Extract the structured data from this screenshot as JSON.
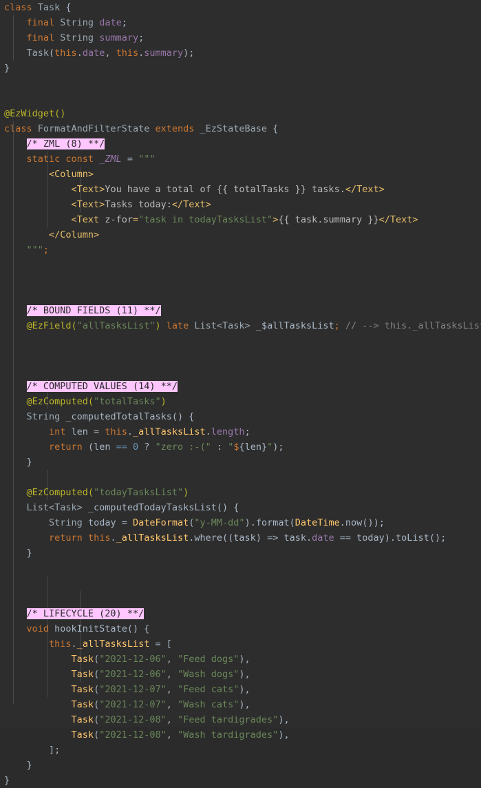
{
  "editor": {
    "background": "#2d2d2d",
    "language": "dart",
    "indent_guide_color": "#4a4a4a",
    "highlight_color": "#ffc6ff",
    "colors": {
      "keyword": "#cc7832",
      "type": "#9aa7b0",
      "field": "#9876aa",
      "string": "#6a8759",
      "annotation": "#bbb529",
      "comment": "#808080",
      "number": "#6897bb",
      "function": "#ffc66d",
      "default": "#a9b7c6",
      "xml_tag": "#e8bf6a"
    }
  },
  "section_headers": [
    {
      "label": "/* ZML (8) **/",
      "line": 8
    },
    {
      "label": "/* BOUND FIELDS (11) **/",
      "line": 11
    },
    {
      "label": "/* COMPUTED VALUES (14) **/",
      "line": 14
    },
    {
      "label": "/* LIFECYCLE (20) **/",
      "line": 20
    }
  ],
  "code": {
    "l1": {
      "kw1": "class",
      "name": " Task ",
      "brace": "{"
    },
    "l2": {
      "kw": "final",
      "type": " String ",
      "field": "date",
      "semi": ";"
    },
    "l3": {
      "kw": "final",
      "type": " String ",
      "field": "summary",
      "semi": ";"
    },
    "l4": {
      "fn": "Task",
      "p1": "(",
      "kw1": "this",
      "d1": ".",
      "f1": "date",
      "c": ", ",
      "kw2": "this",
      "d2": ".",
      "f2": "summary",
      "p2": ");"
    },
    "l5": {
      "brace": "}"
    },
    "l7": {
      "anno": "@EzWidget()"
    },
    "l8": {
      "kw": "class",
      "name": " FormatAndFilterState ",
      "kw2": "extends",
      "base": " _EzStateBase ",
      "brace": "{"
    },
    "l9": {
      "header": "/* ZML (8) **/"
    },
    "l10": {
      "kw1": "static",
      "kw2": " const ",
      "field": "_ZML",
      "eq": " = ",
      "str": "\"\"\""
    },
    "l11": {
      "tag": "<Column>"
    },
    "l12": {
      "open": "<Text>",
      "text": "You have a total of {{ totalTasks }} tasks.",
      "close": "</Text>"
    },
    "l13": {
      "open": "<Text>",
      "text": "Tasks today:",
      "close": "</Text>"
    },
    "l14": {
      "open": "<Text ",
      "attr": "z-for",
      "eq": "=",
      "val": "\"task in todayTasksList\"",
      "gt": ">",
      "text": "{{ task.summary }}",
      "close": "</Text>"
    },
    "l15": {
      "tag": "</Column>"
    },
    "l16": {
      "str": "\"\"\"",
      "semi": ";"
    },
    "l17": {
      "header": "/* BOUND FIELDS (11) **/"
    },
    "l18": {
      "anno": "@EzField",
      "p1": "(",
      "str": "\"allTasksList\"",
      "p2": ")",
      "kw": " late ",
      "type": "List<Task>",
      "field": " _$allTasksList",
      "semi": ";",
      "cmt": " // --> this._allTasksList"
    },
    "l19": {
      "header": "/* COMPUTED VALUES (14) **/"
    },
    "l20": {
      "anno": "@EzComputed",
      "p1": "(",
      "str": "\"totalTasks\"",
      "p2": ")"
    },
    "l21": {
      "type": "String",
      "fn": " _computedTotalTasks",
      "p": "() ",
      "brace": "{"
    },
    "l22": {
      "kw": "int",
      "var": " len ",
      "eq": "= ",
      "kw2": "this",
      "d": ".",
      "field": "_allTasksList",
      "d2": ".",
      "prop": "length",
      "semi": ";"
    },
    "l23": {
      "kw": "return",
      "p1": " (len ",
      "op": "== ",
      "num": "0",
      "q": " ? ",
      "str1": "\"zero :-(\"",
      "colon": " : ",
      "q2": "\"",
      "interp": "$",
      "brace1": "{",
      "ivar": "len",
      "brace2": "}",
      "q3": "\"",
      "p2": ");"
    },
    "l24": {
      "brace": "}"
    },
    "l26": {
      "anno": "@EzComputed",
      "p1": "(",
      "str": "\"todayTasksList\"",
      "p2": ")"
    },
    "l27": {
      "type": "List<Task>",
      "fn": " _computedTodayTasksList",
      "p": "() ",
      "brace": "{"
    },
    "l28": {
      "type": "String",
      "var": " today ",
      "eq": "= ",
      "fn": "DateFormat",
      "p1": "(",
      "str": "\"y-MM-dd\"",
      "p2": ").",
      "fn2": "format",
      "p3": "(",
      "fn3": "DateTime",
      "d": ".",
      "fn4": "now",
      "p4": "());"
    },
    "l29": {
      "kw": "return",
      "kw2": " this",
      "d": ".",
      "field": "_allTasksList",
      "d2": ".",
      "fn": "where",
      "p1": "((task) => task",
      "d3": ".",
      "prop": "date",
      "op": " == ",
      "v": "today",
      "p2": ").",
      "fn2": "toList",
      "p3": "();"
    },
    "l30": {
      "brace": "}"
    },
    "l32": {
      "header": "/* LIFECYCLE (20) **/"
    },
    "l33": {
      "kw": "void",
      "fn": " hookInitState",
      "p": "() ",
      "brace": "{"
    },
    "l34": {
      "kw": "this",
      "d": ".",
      "field": "_allTasksList",
      "eq": " = ",
      "brk": "["
    },
    "tasks": [
      {
        "fn": "Task",
        "date": "\"2021-12-06\"",
        "summary": "\"Feed dogs\""
      },
      {
        "fn": "Task",
        "date": "\"2021-12-06\"",
        "summary": "\"Wash dogs\""
      },
      {
        "fn": "Task",
        "date": "\"2021-12-07\"",
        "summary": "\"Feed cats\""
      },
      {
        "fn": "Task",
        "date": "\"2021-12-07\"",
        "summary": "\"Wash cats\""
      },
      {
        "fn": "Task",
        "date": "\"2021-12-08\"",
        "summary": "\"Feed tardigrades\""
      },
      {
        "fn": "Task",
        "date": "\"2021-12-08\"",
        "summary": "\"Wash tardigrades\""
      }
    ],
    "l41": {
      "brk": "];"
    },
    "l42": {
      "brace": "}"
    },
    "l43": {
      "brace": "}"
    }
  }
}
